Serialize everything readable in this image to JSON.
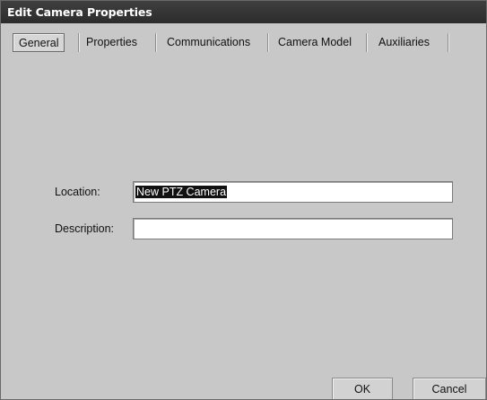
{
  "window": {
    "title": "Edit Camera Properties"
  },
  "tabs": [
    {
      "label": "General",
      "selected": true
    },
    {
      "label": "Properties",
      "selected": false
    },
    {
      "label": "Communications",
      "selected": false
    },
    {
      "label": "Camera Model",
      "selected": false
    },
    {
      "label": "Auxiliaries",
      "selected": false
    }
  ],
  "form": {
    "location_label": "Location:",
    "location_value": "New PTZ Camera",
    "description_label": "Description:",
    "description_value": ""
  },
  "buttons": {
    "ok_label": "OK",
    "cancel_label": "Cancel"
  },
  "colors": {
    "titlebar": "#333333",
    "background": "#c8c8c8",
    "selection": "#111111"
  }
}
